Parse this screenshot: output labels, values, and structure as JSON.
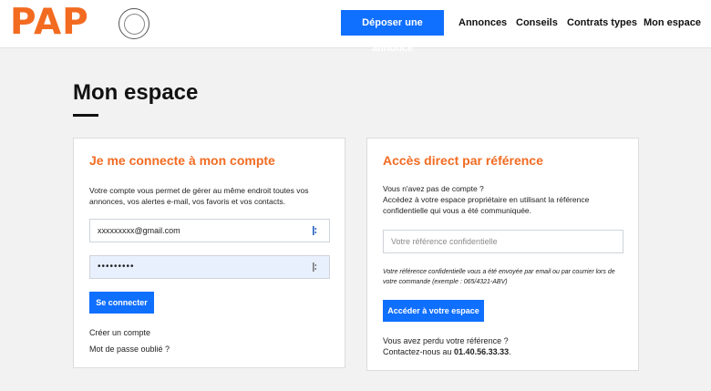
{
  "header": {
    "logo": "PAP",
    "badge_icon": "vacances-seal-icon",
    "cta_label": "Déposer une annonce",
    "nav": [
      "Annonces",
      "Conseils",
      "Contrats types",
      "Mon espace"
    ]
  },
  "page_title": "Mon espace",
  "login_card": {
    "title": "Je me connecte à mon compte",
    "description_line1": "Votre compte vous permet de gérer au même endroit toutes vos",
    "description_line2": "annonces, vos alertes e-mail, vos favoris et vos contacts.",
    "email_value": "xxxxxxxxx@gmail.com",
    "password_value": "•••••••••",
    "submit_label": "Se connecter",
    "create_account": "Créer un compte",
    "forgot_password": "Mot de passe oublié ?"
  },
  "ref_card": {
    "title": "Accès direct par référence",
    "no_account": "Vous n'avez pas de compte ?",
    "desc_line1": "Accédez à votre espace propriétaire en utilisant la référence",
    "desc_line2": "confidentielle qui vous a été communiquée.",
    "ref_placeholder": "Votre référence confidentielle",
    "note_line1": "Votre référence confidentielle vous a été envoyée par email ou par courrier lors de",
    "note_line2": "votre commande (exemple : 065/4321-ABV)",
    "submit_label": "Accéder à votre espace",
    "lost_ref": "Vous avez perdu votre référence ?",
    "contact_prefix": "Contactez-nous au ",
    "phone": "01.40.56.33.33",
    "phone_suffix": "."
  },
  "colors": {
    "brand_orange": "#f26b21",
    "accent_blue": "#0f6fff"
  }
}
